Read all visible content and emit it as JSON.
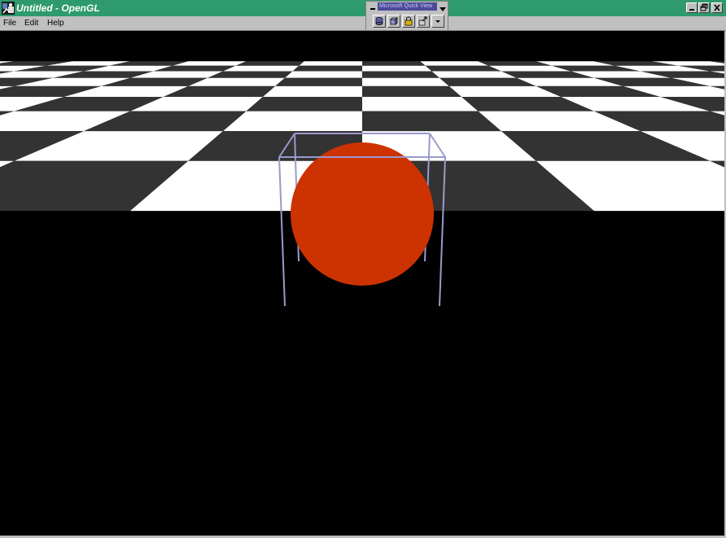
{
  "window": {
    "title": "Untitled - OpenGL",
    "titlebar_color": "#2e9a6e",
    "icon": "app-icon",
    "controls": [
      "minimize-icon",
      "restore-icon",
      "close-icon"
    ]
  },
  "menu": {
    "items": [
      {
        "label": "File"
      },
      {
        "label": "Edit"
      },
      {
        "label": "Help"
      }
    ]
  },
  "toolbar_window": {
    "title": "Microsoft Quick View",
    "buttons": [
      {
        "icon": "cylinder-icon"
      },
      {
        "icon": "cube-icon"
      },
      {
        "icon": "lock-icon"
      },
      {
        "icon": "export-icon"
      },
      {
        "icon": "dropdown-arrow-icon"
      }
    ]
  },
  "scene": {
    "background_color": "#000000",
    "sphere_color": "#cc3300",
    "wireframe_color": "#9a9acd",
    "floor_dark": "#333333",
    "floor_light": "#ffffff"
  }
}
